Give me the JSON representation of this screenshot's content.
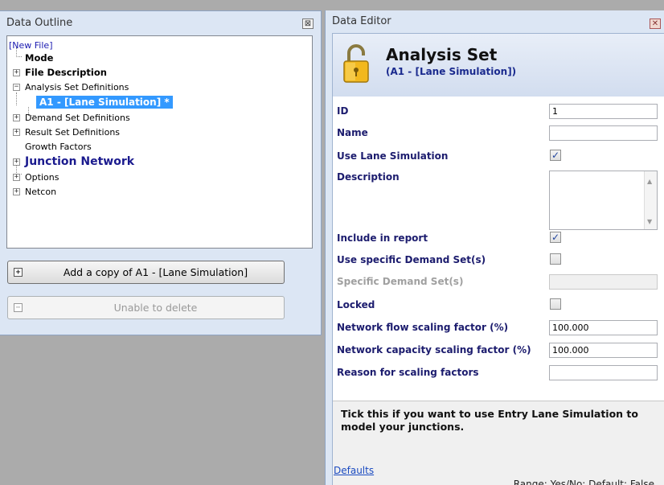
{
  "outline": {
    "title": "Data Outline",
    "close_symbol": "⊠",
    "tree": [
      {
        "label": "[New File]",
        "style": "link"
      },
      {
        "label": "Mode",
        "style": "bold"
      },
      {
        "label": "File Description",
        "style": "bold",
        "expander": "+"
      },
      {
        "label": "Analysis Set Definitions",
        "style": "normal",
        "expander": "−"
      },
      {
        "label": "A1 - [Lane Simulation] *",
        "style": "selected"
      },
      {
        "label": "Demand Set Definitions",
        "style": "normal",
        "expander": "+"
      },
      {
        "label": "Result Set Definitions",
        "style": "normal",
        "expander": "+"
      },
      {
        "label": "Growth Factors",
        "style": "normal"
      },
      {
        "label": "Junction Network",
        "style": "big",
        "expander": "+"
      },
      {
        "label": "Options",
        "style": "normal",
        "expander": "+"
      },
      {
        "label": "Netcon",
        "style": "normal",
        "expander": "+"
      }
    ],
    "add_copy_label": "Add a copy of A1 - [Lane Simulation]",
    "add_copy_icon": "+",
    "delete_label": "Unable to delete",
    "delete_icon": "−"
  },
  "editor": {
    "title": "Data Editor",
    "close_symbol": "✕",
    "heading": "Analysis Set",
    "subheading": "(A1 - [Lane Simulation])",
    "icon": "padlock-icon",
    "properties": {
      "id_label": "ID",
      "id_value": "1",
      "name_label": "Name",
      "name_value": "",
      "use_lane_sim_label": "Use Lane Simulation",
      "use_lane_sim_check": "✓",
      "description_label": "Description",
      "description_value": "",
      "include_report_label": "Include in report",
      "include_report_check": "✓",
      "use_specific_label": "Use specific Demand Set(s)",
      "use_specific_check": "",
      "specific_sets_label": "Specific Demand Set(s)",
      "specific_sets_value": "",
      "locked_label": "Locked",
      "locked_check": "",
      "flow_scaling_label": "Network flow scaling factor (%)",
      "flow_scaling_value": "100.000",
      "capacity_scaling_label": "Network capacity scaling factor (%)",
      "capacity_scaling_value": "100.000",
      "reason_label": "Reason for scaling factors",
      "reason_value": ""
    },
    "help_text": "Tick this if you want to use Entry Lane Simulation to model your junctions.",
    "help_range": "Range: Yes/No; Default: False",
    "defaults_link": "Defaults"
  },
  "colors": {
    "panel_bg": "#dce6f4",
    "selection": "#3399ff",
    "label_blue": "#1c1c6e",
    "desktop": "#ababab"
  }
}
